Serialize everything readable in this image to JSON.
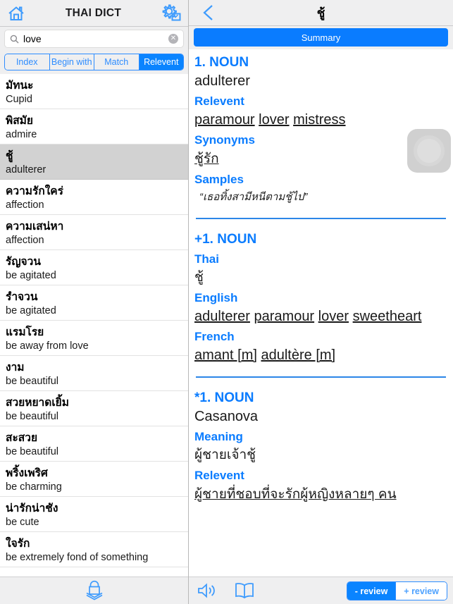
{
  "left": {
    "header": {
      "title": "THAI DICT",
      "home_icon": "home-icon",
      "settings_icon": "gear-document-icon"
    },
    "search": {
      "value": "love",
      "placeholder": "Search",
      "search_icon": "search-icon",
      "clear_icon": "clear-icon",
      "clear_glyph": "✕"
    },
    "segments": [
      {
        "label": "Index",
        "active": false
      },
      {
        "label": "Begin with",
        "active": false
      },
      {
        "label": "Match",
        "active": false
      },
      {
        "label": "Relevent",
        "active": true
      }
    ],
    "results": [
      {
        "thai": "มัทนะ",
        "english": "Cupid",
        "selected": false
      },
      {
        "thai": "พิสมัย",
        "english": "admire",
        "selected": false
      },
      {
        "thai": "ชู้",
        "english": "adulterer",
        "selected": true
      },
      {
        "thai": "ความรักใคร่",
        "english": "affection",
        "selected": false
      },
      {
        "thai": "ความเสน่หา",
        "english": "affection",
        "selected": false
      },
      {
        "thai": "รัญจวน",
        "english": "be agitated",
        "selected": false
      },
      {
        "thai": "รำจวน",
        "english": "be agitated",
        "selected": false
      },
      {
        "thai": "แรมโรย",
        "english": "be away from love",
        "selected": false
      },
      {
        "thai": "งาม",
        "english": "be beautiful",
        "selected": false
      },
      {
        "thai": "สวยหยาดเยิ้ม",
        "english": "be beautiful",
        "selected": false
      },
      {
        "thai": "สะสวย",
        "english": "be beautiful",
        "selected": false
      },
      {
        "thai": "พริ้งเพริศ",
        "english": "be charming",
        "selected": false
      },
      {
        "thai": "น่ารักน่าชัง",
        "english": "be cute",
        "selected": false
      },
      {
        "thai": "ใจรัก",
        "english": "be extremely fond of something",
        "selected": false
      }
    ],
    "footer": {
      "download_icon": "bag-download-icon"
    }
  },
  "right": {
    "header": {
      "back_icon": "chevron-left-icon",
      "title": "ชู้"
    },
    "summary_label": "Summary",
    "float_button": {
      "icon": "record-circle-icon"
    },
    "sections": [
      {
        "heading": "1. NOUN",
        "definition": "adulterer",
        "fields": [
          {
            "label": "Relevent",
            "links": [
              "paramour",
              "lover",
              "mistress"
            ],
            "script": "latin"
          },
          {
            "label": "Synonyms",
            "links": [
              "ชู้รัก"
            ],
            "script": "thai"
          },
          {
            "label": "Samples",
            "sample": "“เธอทิ้งสามีหนีตามชู้ไป”"
          }
        ]
      },
      {
        "heading": "+1. NOUN",
        "definition": "",
        "fields": [
          {
            "label": "Thai",
            "plain_thai": "ชู้"
          },
          {
            "label": "English",
            "links": [
              "adulterer",
              "paramour",
              "lover",
              "sweetheart"
            ],
            "script": "latin"
          },
          {
            "label": "French",
            "links": [
              "amant [m]",
              "adultère [m]"
            ],
            "script": "latin"
          }
        ]
      },
      {
        "heading": "*1. NOUN",
        "definition": "Casanova",
        "fields": [
          {
            "label": "Meaning",
            "plain_thai": "ผู้ชายเจ้าชู้"
          },
          {
            "label": "Relevent",
            "links": [
              "ผู้ชายที่ชอบที่จะรักผู้หญิงหลายๆ คน"
            ],
            "script": "thai"
          }
        ]
      }
    ],
    "footer": {
      "speaker_icon": "speaker-icon",
      "book_icon": "book-icon",
      "review_minus": "- review",
      "review_plus": "+ review"
    }
  },
  "colors": {
    "accent_blue": "#0a7cff",
    "segment_blue": "#0a84ff",
    "chrome_gray": "#efeff0",
    "selected_row": "#d2d2d2"
  }
}
